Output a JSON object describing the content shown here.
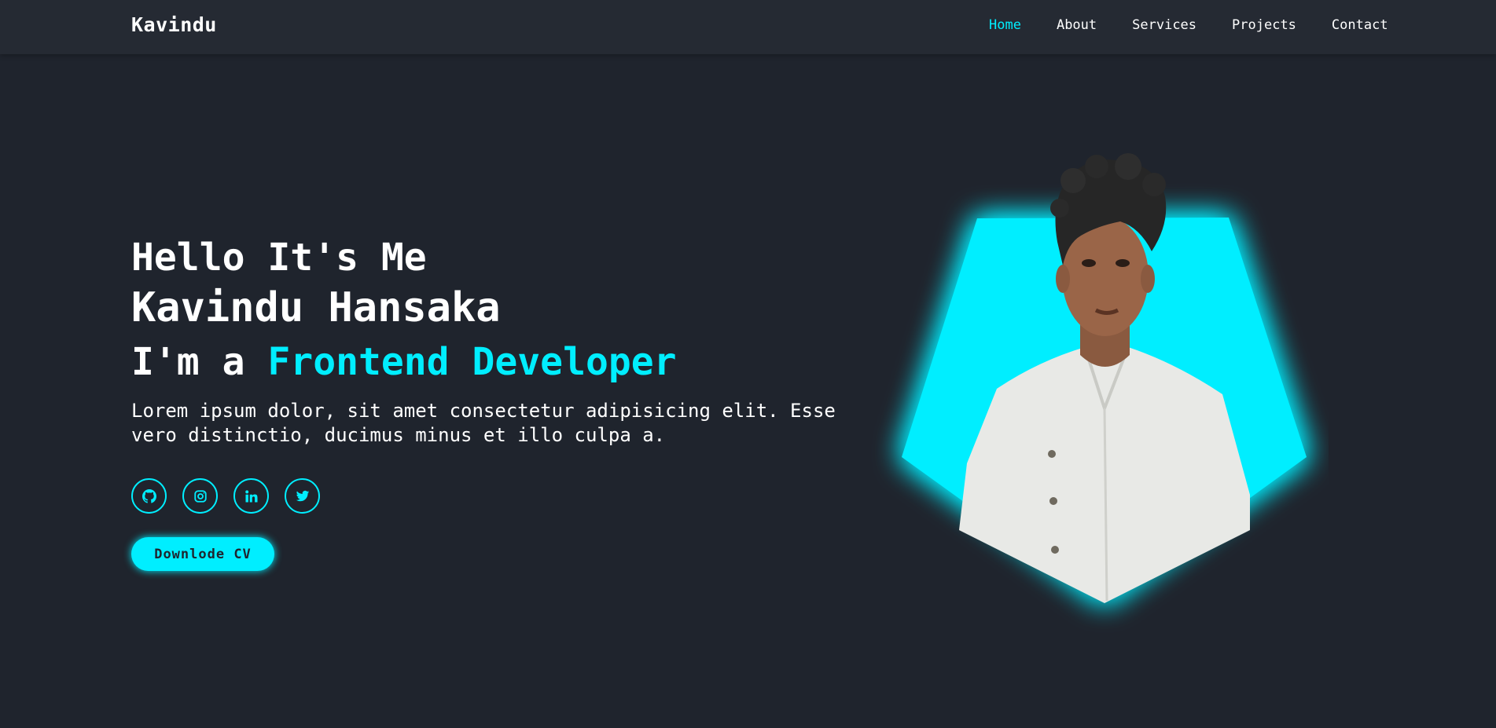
{
  "header": {
    "logo": "Kavindu",
    "nav": [
      {
        "label": "Home",
        "active": true
      },
      {
        "label": "About",
        "active": false
      },
      {
        "label": "Services",
        "active": false
      },
      {
        "label": "Projects",
        "active": false
      },
      {
        "label": "Contact",
        "active": false
      }
    ]
  },
  "hero": {
    "greeting": "Hello It's Me",
    "name": "Kavindu Hansaka",
    "role_prefix": "I'm a ",
    "role": "Frontend Developer",
    "description": "Lorem ipsum dolor, sit amet consectetur adipisicing elit. Esse vero distinctio, ducimus minus et illo culpa a.",
    "socials": [
      {
        "icon": "github-icon"
      },
      {
        "icon": "instagram-icon"
      },
      {
        "icon": "linkedin-icon"
      },
      {
        "icon": "twitter-icon"
      }
    ],
    "cta_label": "Downlode CV"
  },
  "colors": {
    "background": "#1f242d",
    "header_background": "#252a33",
    "accent": "#00eeff",
    "text": "#ffffff"
  }
}
